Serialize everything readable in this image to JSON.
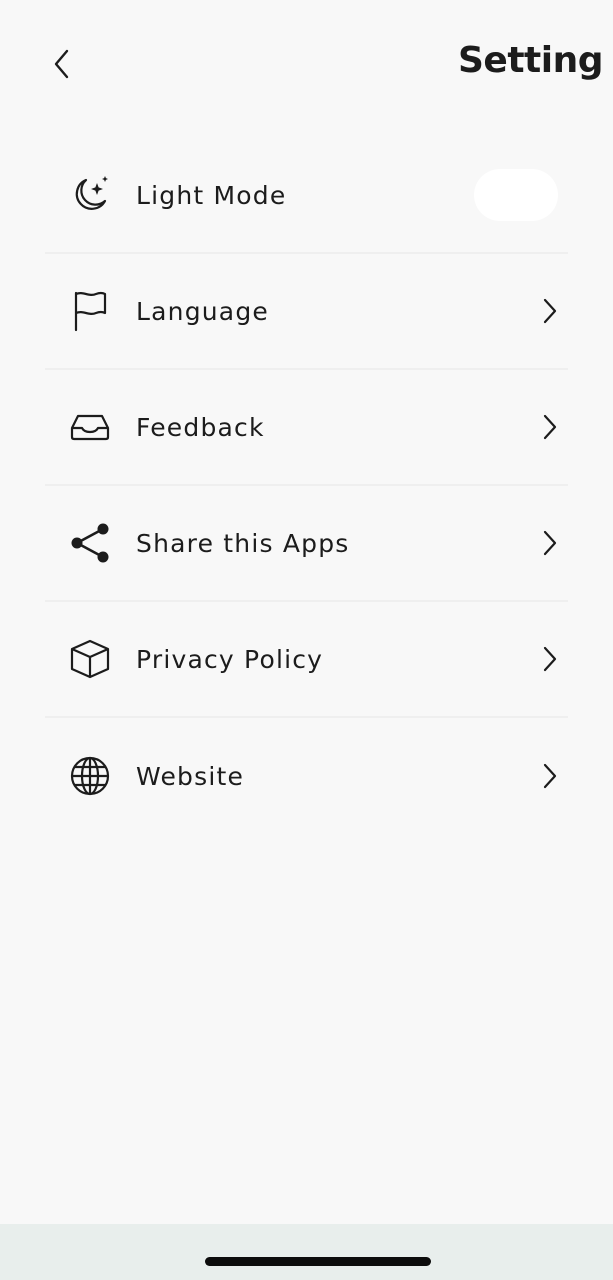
{
  "header": {
    "title": "Setting",
    "back_icon": "chevron-left-icon"
  },
  "menu": {
    "items": [
      {
        "label": "Light Mode",
        "icon": "moon-stars-icon",
        "control": "toggle",
        "toggle_on": false
      },
      {
        "label": "Language",
        "icon": "flag-icon",
        "control": "chevron"
      },
      {
        "label": "Feedback",
        "icon": "inbox-tray-icon",
        "control": "chevron"
      },
      {
        "label": "Share this Apps",
        "icon": "share-icon",
        "control": "chevron"
      },
      {
        "label": "Privacy Policy",
        "icon": "box-icon",
        "control": "chevron"
      },
      {
        "label": "Website",
        "icon": "globe-icon",
        "control": "chevron"
      }
    ]
  },
  "colors": {
    "background": "#f8f8f8",
    "text": "#1c1c1c",
    "divider": "#efefef",
    "toggle_track": "#ffffff",
    "bottom_bar": "#e8eeec",
    "home_indicator": "#0c0c0c"
  }
}
